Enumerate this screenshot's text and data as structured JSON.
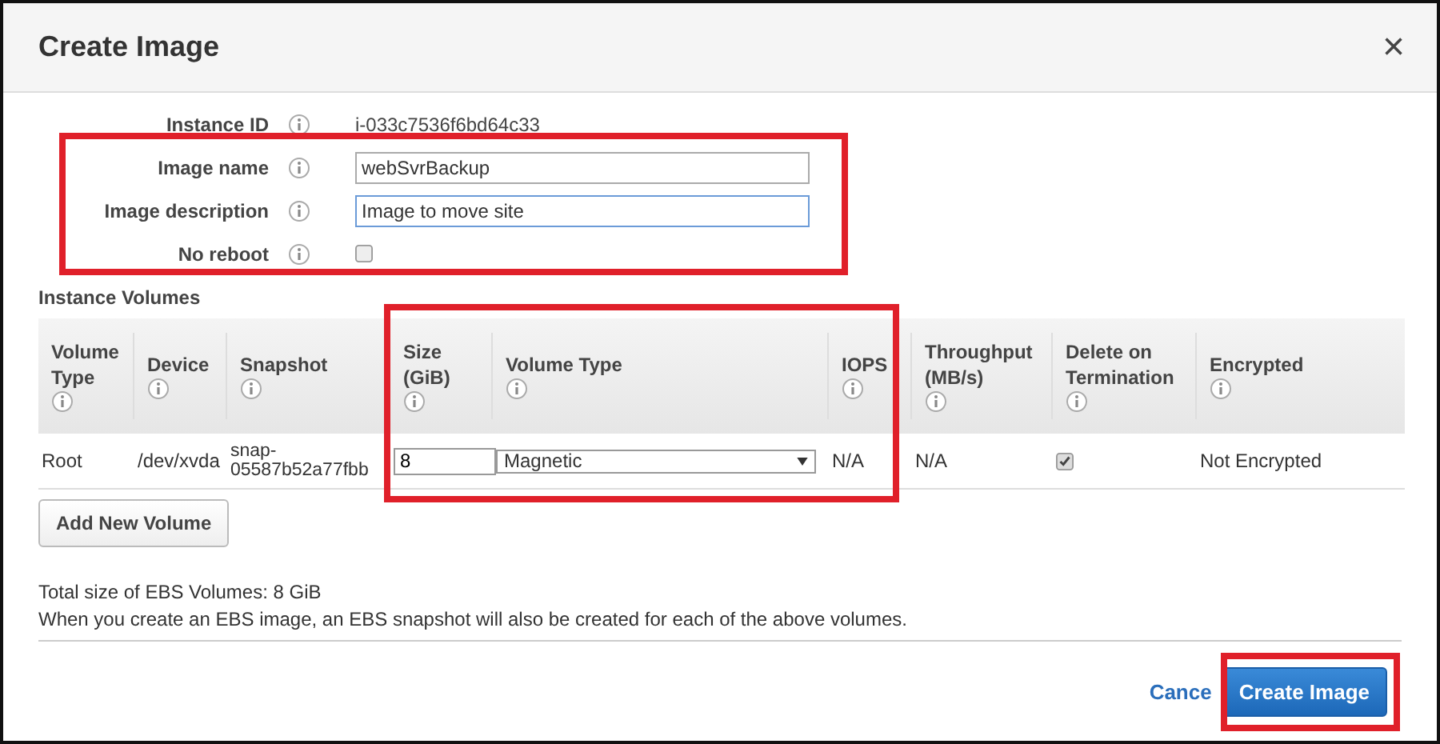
{
  "dialog": {
    "title": "Create Image",
    "close": "×"
  },
  "fields": [
    {
      "kind": "text",
      "label": "Instance ID",
      "value": "i-033c7536f6bd64c33"
    },
    {
      "kind": "input",
      "label": "Image name",
      "value": "webSvrBackup",
      "focused": false
    },
    {
      "kind": "input",
      "label": "Image description",
      "value": "Image to move site",
      "focused": true
    },
    {
      "kind": "checkbox",
      "label": "No reboot",
      "checked": false
    }
  ],
  "volumes": {
    "title": "Instance Volumes",
    "columns": [
      {
        "label": "Volume Type"
      },
      {
        "label": "Device"
      },
      {
        "label": "Snapshot"
      },
      {
        "label": "Size (GiB)"
      },
      {
        "label": "Volume Type"
      },
      {
        "label": "IOPS"
      },
      {
        "label": "Throughput (MB/s)"
      },
      {
        "label": "Delete on Termination"
      },
      {
        "label": "Encrypted"
      }
    ],
    "rows": [
      {
        "volume_type": "Root",
        "device": "/dev/xvda",
        "snapshot": "snap-05587b52a77fbb",
        "size": "8",
        "type": "Magnetic",
        "iops": "N/A",
        "throughput": "N/A",
        "delete_on_termination": true,
        "encrypted": "Not Encrypted"
      }
    ],
    "add_button": "Add New Volume"
  },
  "summary": [
    "Total size of EBS Volumes: 8 GiB",
    "When you create an EBS image, an EBS snapshot will also be created for each of the above volumes."
  ],
  "footer": {
    "cancel": "Cance",
    "submit": "Create Image"
  }
}
